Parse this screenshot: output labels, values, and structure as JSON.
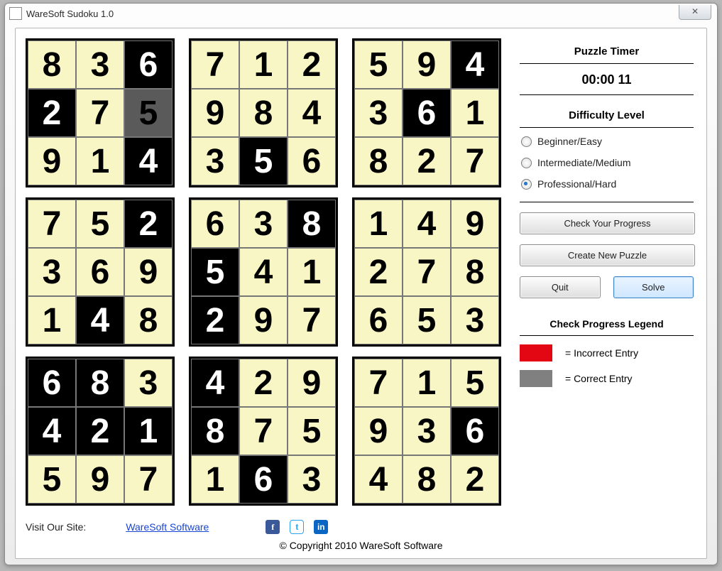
{
  "window": {
    "title": "WareSoft Sudoku 1.0",
    "close_glyph": "✕"
  },
  "grid": {
    "cells": [
      [
        {
          "v": "8",
          "s": "yellow"
        },
        {
          "v": "3",
          "s": "yellow"
        },
        {
          "v": "6",
          "s": "black"
        },
        {
          "v": "7",
          "s": "yellow"
        },
        {
          "v": "1",
          "s": "yellow"
        },
        {
          "v": "2",
          "s": "yellow"
        },
        {
          "v": "5",
          "s": "yellow"
        },
        {
          "v": "9",
          "s": "yellow"
        },
        {
          "v": "4",
          "s": "black"
        }
      ],
      [
        {
          "v": "2",
          "s": "black"
        },
        {
          "v": "7",
          "s": "yellow"
        },
        {
          "v": "5",
          "s": "gray"
        },
        {
          "v": "9",
          "s": "yellow"
        },
        {
          "v": "8",
          "s": "yellow"
        },
        {
          "v": "4",
          "s": "yellow"
        },
        {
          "v": "3",
          "s": "yellow"
        },
        {
          "v": "6",
          "s": "black"
        },
        {
          "v": "1",
          "s": "yellow"
        }
      ],
      [
        {
          "v": "9",
          "s": "yellow"
        },
        {
          "v": "1",
          "s": "yellow"
        },
        {
          "v": "4",
          "s": "black"
        },
        {
          "v": "3",
          "s": "yellow"
        },
        {
          "v": "5",
          "s": "black"
        },
        {
          "v": "6",
          "s": "yellow"
        },
        {
          "v": "8",
          "s": "yellow"
        },
        {
          "v": "2",
          "s": "yellow"
        },
        {
          "v": "7",
          "s": "yellow"
        }
      ],
      [
        {
          "v": "7",
          "s": "yellow"
        },
        {
          "v": "5",
          "s": "yellow"
        },
        {
          "v": "2",
          "s": "black"
        },
        {
          "v": "6",
          "s": "yellow"
        },
        {
          "v": "3",
          "s": "yellow"
        },
        {
          "v": "8",
          "s": "black"
        },
        {
          "v": "1",
          "s": "yellow"
        },
        {
          "v": "4",
          "s": "yellow"
        },
        {
          "v": "9",
          "s": "yellow"
        }
      ],
      [
        {
          "v": "3",
          "s": "yellow"
        },
        {
          "v": "6",
          "s": "yellow"
        },
        {
          "v": "9",
          "s": "yellow"
        },
        {
          "v": "5",
          "s": "black"
        },
        {
          "v": "4",
          "s": "yellow"
        },
        {
          "v": "1",
          "s": "yellow"
        },
        {
          "v": "2",
          "s": "yellow"
        },
        {
          "v": "7",
          "s": "yellow"
        },
        {
          "v": "8",
          "s": "yellow"
        }
      ],
      [
        {
          "v": "1",
          "s": "yellow"
        },
        {
          "v": "4",
          "s": "black"
        },
        {
          "v": "8",
          "s": "yellow"
        },
        {
          "v": "2",
          "s": "black"
        },
        {
          "v": "9",
          "s": "yellow"
        },
        {
          "v": "7",
          "s": "yellow"
        },
        {
          "v": "6",
          "s": "yellow"
        },
        {
          "v": "5",
          "s": "yellow"
        },
        {
          "v": "3",
          "s": "yellow"
        }
      ],
      [
        {
          "v": "6",
          "s": "black"
        },
        {
          "v": "8",
          "s": "black"
        },
        {
          "v": "3",
          "s": "yellow"
        },
        {
          "v": "4",
          "s": "black"
        },
        {
          "v": "2",
          "s": "yellow"
        },
        {
          "v": "9",
          "s": "yellow"
        },
        {
          "v": "7",
          "s": "yellow"
        },
        {
          "v": "1",
          "s": "yellow"
        },
        {
          "v": "5",
          "s": "yellow"
        }
      ],
      [
        {
          "v": "4",
          "s": "black"
        },
        {
          "v": "2",
          "s": "black"
        },
        {
          "v": "1",
          "s": "black"
        },
        {
          "v": "8",
          "s": "black"
        },
        {
          "v": "7",
          "s": "yellow"
        },
        {
          "v": "5",
          "s": "yellow"
        },
        {
          "v": "9",
          "s": "yellow"
        },
        {
          "v": "3",
          "s": "yellow"
        },
        {
          "v": "6",
          "s": "black"
        }
      ],
      [
        {
          "v": "5",
          "s": "yellow"
        },
        {
          "v": "9",
          "s": "yellow"
        },
        {
          "v": "7",
          "s": "yellow"
        },
        {
          "v": "1",
          "s": "yellow"
        },
        {
          "v": "6",
          "s": "black"
        },
        {
          "v": "3",
          "s": "yellow"
        },
        {
          "v": "4",
          "s": "yellow"
        },
        {
          "v": "8",
          "s": "yellow"
        },
        {
          "v": "2",
          "s": "yellow"
        }
      ]
    ]
  },
  "sidebar": {
    "timer_title": "Puzzle Timer",
    "timer_value": "00:00 11",
    "difficulty_title": "Difficulty Level",
    "difficulty_options": [
      {
        "label": "Beginner/Easy",
        "checked": false
      },
      {
        "label": "Intermediate/Medium",
        "checked": false
      },
      {
        "label": "Professional/Hard",
        "checked": true
      }
    ],
    "btn_check": "Check Your Progress",
    "btn_new": "Create New Puzzle",
    "btn_quit": "Quit",
    "btn_solve": "Solve",
    "legend_title": "Check Progress Legend",
    "legend_incorrect": "= Incorrect Entry",
    "legend_correct": "= Correct Entry"
  },
  "footer": {
    "visit": "Visit Our Site:",
    "link": "WareSoft Software",
    "social": {
      "fb": "f",
      "tw": "t",
      "li": "in"
    },
    "copyright": "© Copyright 2010 WareSoft Software"
  }
}
